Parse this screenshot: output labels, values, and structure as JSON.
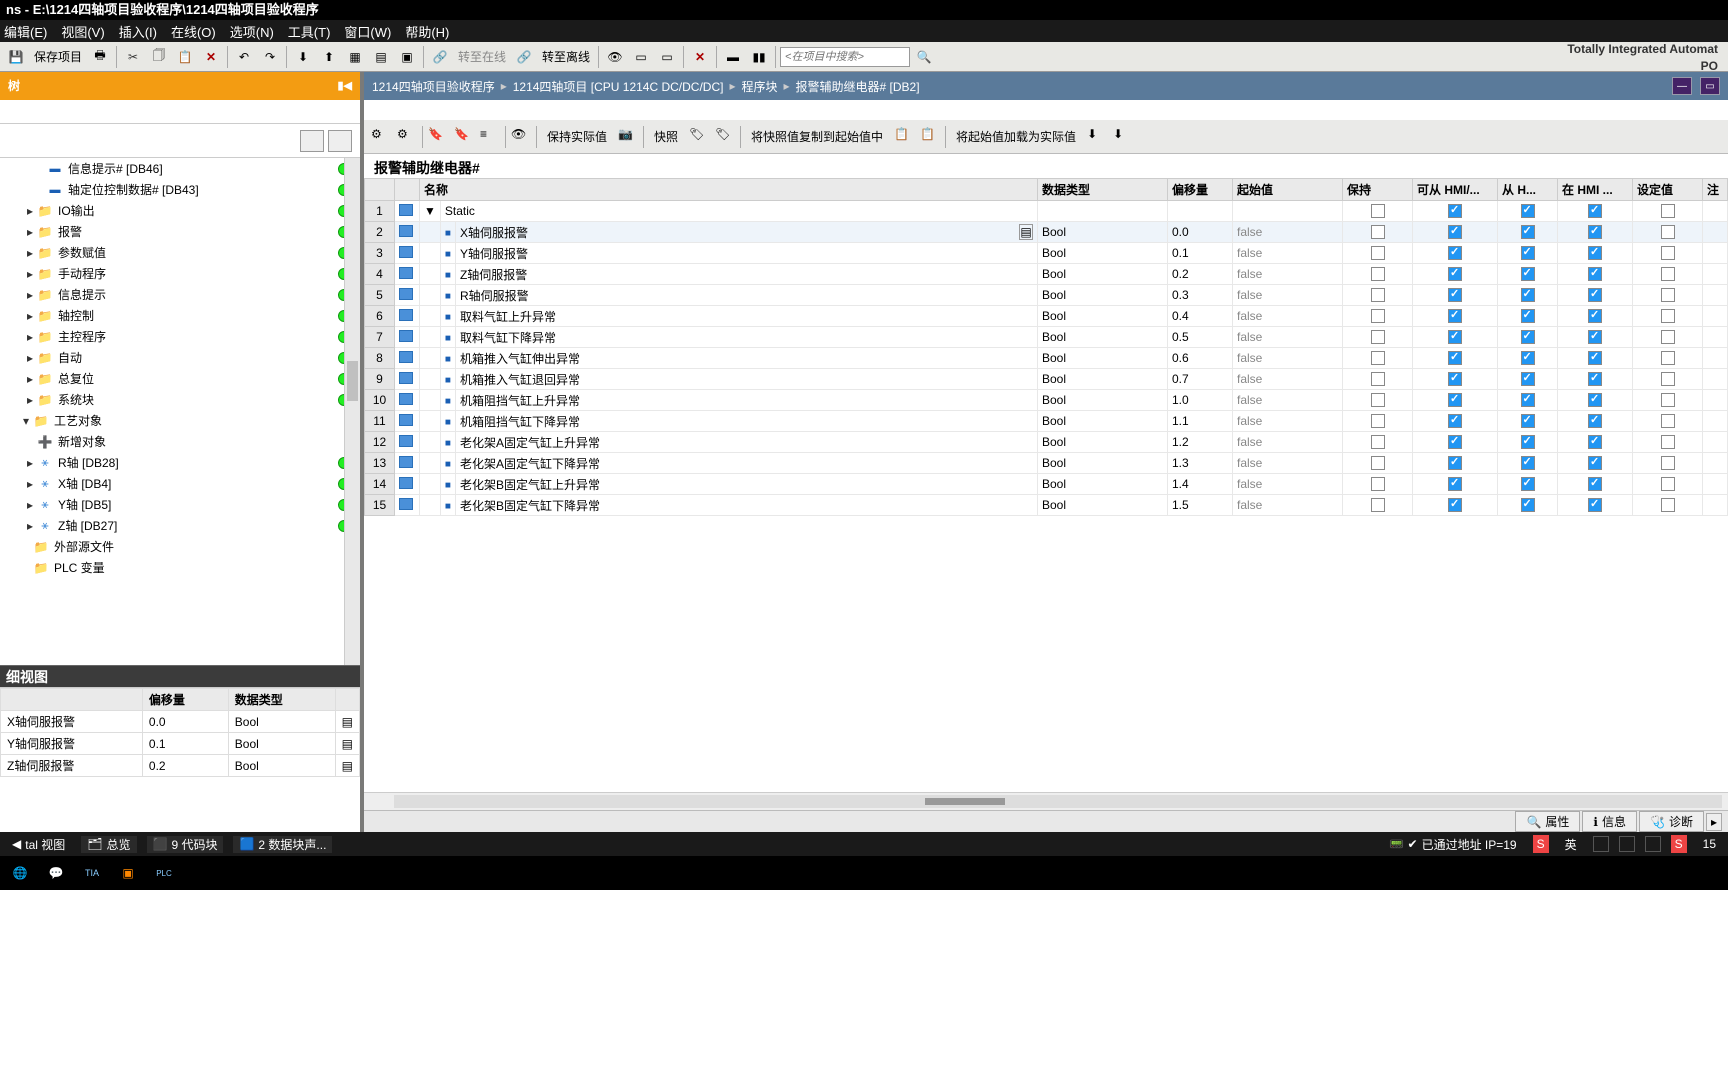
{
  "titlebar": "ns  -  E:\\1214四轴项目验收程序\\1214四轴项目验收程序",
  "branding": {
    "line1": "Totally Integrated Automat",
    "line2": "PO"
  },
  "menu": [
    "编辑(E)",
    "视图(V)",
    "插入(I)",
    "在线(O)",
    "选项(N)",
    "工具(T)",
    "窗口(W)",
    "帮助(H)"
  ],
  "toolbar": {
    "save_project": "保存项目",
    "go_online": "转至在线",
    "go_offline": "转至离线",
    "search_placeholder": "<在项目中搜索>"
  },
  "tree": {
    "header": "树",
    "items": [
      {
        "icon": "db",
        "label": "信息提示# [DB46]",
        "dot": true,
        "ind": 1
      },
      {
        "icon": "db",
        "label": "轴定位控制数据# [DB43]",
        "dot": true,
        "ind": 1
      },
      {
        "icon": "folder",
        "label": "IO输出",
        "dot": true,
        "exp": true,
        "ind": 0
      },
      {
        "icon": "folder",
        "label": "报警",
        "dot": true,
        "exp": true,
        "ind": 0
      },
      {
        "icon": "folder",
        "label": "参数赋值",
        "dot": true,
        "exp": true,
        "ind": 0
      },
      {
        "icon": "folder",
        "label": "手动程序",
        "dot": true,
        "exp": true,
        "ind": 0
      },
      {
        "icon": "folder",
        "label": "信息提示",
        "dot": true,
        "exp": true,
        "ind": 0
      },
      {
        "icon": "folder",
        "label": "轴控制",
        "dot": true,
        "exp": true,
        "ind": 0
      },
      {
        "icon": "folder",
        "label": "主控程序",
        "dot": true,
        "exp": true,
        "ind": 0
      },
      {
        "icon": "folder",
        "label": "自动",
        "dot": true,
        "exp": true,
        "ind": 0
      },
      {
        "icon": "folder",
        "label": "总复位",
        "dot": true,
        "exp": true,
        "ind": 0
      },
      {
        "icon": "folder",
        "label": "系统块",
        "dot": true,
        "exp": true,
        "ind": 0
      },
      {
        "icon": "folder",
        "label": "工艺对象",
        "dot": false,
        "exp": true,
        "ind": -1,
        "open": true
      },
      {
        "icon": "add",
        "label": "新增对象",
        "dot": false,
        "ind": 0
      },
      {
        "icon": "axis",
        "label": "R轴 [DB28]",
        "dot": true,
        "exp": true,
        "ind": 0
      },
      {
        "icon": "axis",
        "label": "X轴 [DB4]",
        "dot": true,
        "exp": true,
        "ind": 0
      },
      {
        "icon": "axis",
        "label": "Y轴 [DB5]",
        "dot": true,
        "exp": true,
        "ind": 0
      },
      {
        "icon": "axis",
        "label": "Z轴 [DB27]",
        "dot": true,
        "exp": true,
        "ind": 0
      },
      {
        "icon": "folder",
        "label": "外部源文件",
        "dot": false,
        "ind": -1
      },
      {
        "icon": "folder",
        "label": "PLC 变量",
        "dot": false,
        "ind": -1
      }
    ]
  },
  "detail": {
    "header": "细视图",
    "columns": [
      "",
      "偏移量",
      "数据类型"
    ],
    "rows": [
      {
        "name": "X轴伺服报警",
        "offset": "0.0",
        "type": "Bool"
      },
      {
        "name": "Y轴伺服报警",
        "offset": "0.1",
        "type": "Bool"
      },
      {
        "name": "Z轴伺服报警",
        "offset": "0.2",
        "type": "Bool"
      }
    ]
  },
  "breadcrumb": [
    "1214四轴项目验收程序",
    "1214四轴项目 [CPU 1214C DC/DC/DC]",
    "程序块",
    "报警辅助继电器# [DB2]"
  ],
  "right_toolbar": {
    "keep_actual": "保持实际值",
    "snapshot": "快照",
    "copy_snapshot": "将快照值复制到起始值中",
    "load_start": "将起始值加载为实际值"
  },
  "block": {
    "title": "报警辅助继电器#"
  },
  "columns": {
    "name": "名称",
    "dtype": "数据类型",
    "offset": "偏移量",
    "start": "起始值",
    "retain": "保持",
    "hmi_r": "可从 HMI/...",
    "hmi_w": "从 H...",
    "hmi_v": "在 HMI ...",
    "setpoint": "设定值",
    "comment": "注"
  },
  "static_label": "Static",
  "rows": [
    {
      "n": 2,
      "name": "X轴伺服报警",
      "type": "Bool",
      "offset": "0.0",
      "start": "false",
      "retain": false,
      "r": true,
      "w": true,
      "v": true,
      "sp": false,
      "sel": true
    },
    {
      "n": 3,
      "name": "Y轴伺服报警",
      "type": "Bool",
      "offset": "0.1",
      "start": "false",
      "retain": false,
      "r": true,
      "w": true,
      "v": true,
      "sp": false
    },
    {
      "n": 4,
      "name": "Z轴伺服报警",
      "type": "Bool",
      "offset": "0.2",
      "start": "false",
      "retain": false,
      "r": true,
      "w": true,
      "v": true,
      "sp": false
    },
    {
      "n": 5,
      "name": "R轴伺服报警",
      "type": "Bool",
      "offset": "0.3",
      "start": "false",
      "retain": false,
      "r": true,
      "w": true,
      "v": true,
      "sp": false
    },
    {
      "n": 6,
      "name": "取料气缸上升异常",
      "type": "Bool",
      "offset": "0.4",
      "start": "false",
      "retain": false,
      "r": true,
      "w": true,
      "v": true,
      "sp": false
    },
    {
      "n": 7,
      "name": "取料气缸下降异常",
      "type": "Bool",
      "offset": "0.5",
      "start": "false",
      "retain": false,
      "r": true,
      "w": true,
      "v": true,
      "sp": false
    },
    {
      "n": 8,
      "name": "机箱推入气缸伸出异常",
      "type": "Bool",
      "offset": "0.6",
      "start": "false",
      "retain": false,
      "r": true,
      "w": true,
      "v": true,
      "sp": false
    },
    {
      "n": 9,
      "name": "机箱推入气缸退回异常",
      "type": "Bool",
      "offset": "0.7",
      "start": "false",
      "retain": false,
      "r": true,
      "w": true,
      "v": true,
      "sp": false
    },
    {
      "n": 10,
      "name": "机箱阻挡气缸上升异常",
      "type": "Bool",
      "offset": "1.0",
      "start": "false",
      "retain": false,
      "r": true,
      "w": true,
      "v": true,
      "sp": false
    },
    {
      "n": 11,
      "name": "机箱阻挡气缸下降异常",
      "type": "Bool",
      "offset": "1.1",
      "start": "false",
      "retain": false,
      "r": true,
      "w": true,
      "v": true,
      "sp": false
    },
    {
      "n": 12,
      "name": "老化架A固定气缸上升异常",
      "type": "Bool",
      "offset": "1.2",
      "start": "false",
      "retain": false,
      "r": true,
      "w": true,
      "v": true,
      "sp": false
    },
    {
      "n": 13,
      "name": "老化架A固定气缸下降异常",
      "type": "Bool",
      "offset": "1.3",
      "start": "false",
      "retain": false,
      "r": true,
      "w": true,
      "v": true,
      "sp": false
    },
    {
      "n": 14,
      "name": "老化架B固定气缸上升异常",
      "type": "Bool",
      "offset": "1.4",
      "start": "false",
      "retain": false,
      "r": true,
      "w": true,
      "v": true,
      "sp": false
    },
    {
      "n": 15,
      "name": "老化架B固定气缸下降异常",
      "type": "Bool",
      "offset": "1.5",
      "start": "false",
      "retain": false,
      "r": true,
      "w": true,
      "v": true,
      "sp": false
    }
  ],
  "bottom_tabs": {
    "props": "属性",
    "info": "信息",
    "diag": "诊断"
  },
  "status": {
    "portal": "tal  视图",
    "overview": "总览",
    "codeblocks": "9 代码块",
    "datablocks": "2 数据块声...",
    "connected": "已通过地址 IP=19",
    "ime": "英",
    "time": "15"
  }
}
